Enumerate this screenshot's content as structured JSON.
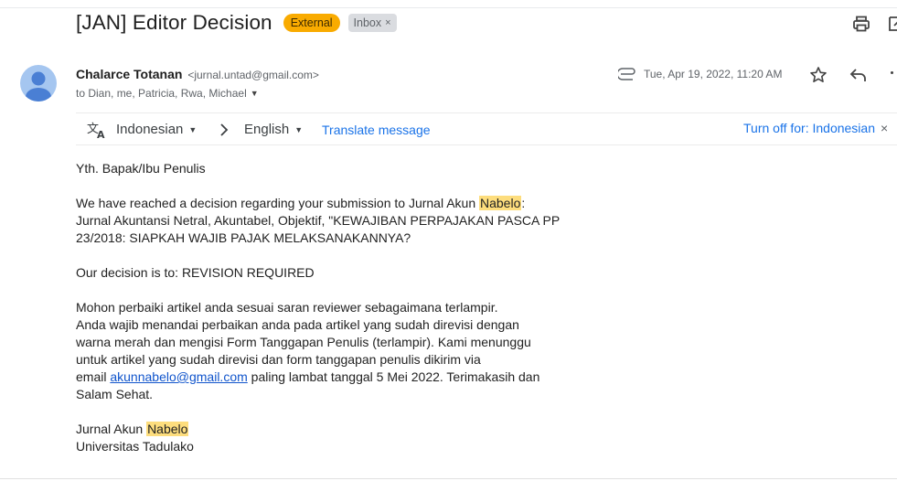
{
  "subject": {
    "title": "[JAN] Editor Decision",
    "external_label": "External",
    "inbox_label": "Inbox",
    "inbox_close": "×"
  },
  "sender": {
    "name": "Chalarce Totanan",
    "email": "<jurnal.untad@gmail.com>",
    "recipients": "to Dian, me, Patricia, Rwa, Michael",
    "date": "Tue, Apr 19, 2022, 11:20 AM"
  },
  "translate": {
    "from_lang": "Indonesian",
    "to_lang": "English",
    "translate_link": "Translate message",
    "turn_off": "Turn off for: Indonesian",
    "close": "×"
  },
  "body": {
    "greeting": "Yth. Bapak/Ibu Penulis",
    "p1_pre": "We have reached a decision regarding your submission to Jurnal Akun ",
    "highlight": "Nabelo",
    "p1_post": ":",
    "p1_line2": "Jurnal Akuntansi Netral, Akuntabel, Objektif, \"KEWAJIBAN PERPAJAKAN PASCA PP",
    "p1_line3": "23/2018: SIAPKAH WAJIB PAJAK MELAKSANAKANNYA?",
    "decision": "Our decision is to: REVISION REQUIRED",
    "p3_line1": "Mohon perbaiki artikel anda sesuai saran reviewer sebagaimana terlampir.",
    "p3_line2": "Anda wajib menandai perbaikan anda pada artikel yang sudah direvisi dengan",
    "p3_line3": "warna merah dan mengisi Form Tanggapan Penulis (terlampir). Kami menunggu",
    "p3_line4": "untuk artikel yang sudah direvisi dan form tanggapan penulis dikirim via",
    "p3_line5_pre": "email ",
    "p3_email": "akunnabelo@gmail.com",
    "p3_line5_post": " paling lambat tanggal 5 Mei 2022. Terimakasih dan",
    "p3_line6": "Salam Sehat.",
    "sig_pre": "Jurnal Akun ",
    "sig_highlight": "Nabelo",
    "sig_line2": "Universitas Tadulako"
  },
  "colors": {
    "external_badge": "#f9ab00",
    "link": "#1a73e8",
    "highlight": "#fddd7d"
  },
  "icons": [
    "print-icon",
    "open-in-new-window-icon",
    "avatar-icon",
    "attachment-icon",
    "star-icon",
    "reply-icon",
    "more-options-icon",
    "translate-icon",
    "chevron-right-icon"
  ]
}
